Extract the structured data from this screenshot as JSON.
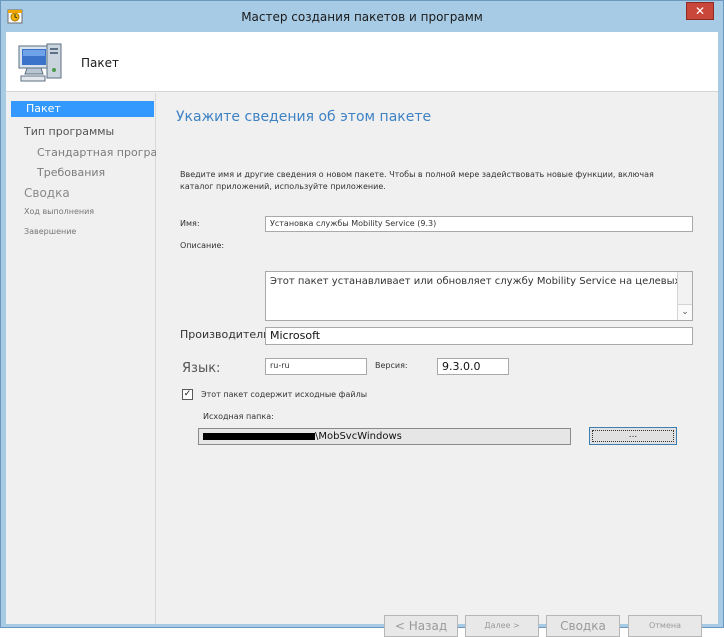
{
  "window": {
    "title": "Мастер создания пакетов и программ",
    "close_glyph": "✕"
  },
  "header": {
    "title": "Пакет",
    "icon": "computer-icon"
  },
  "nav": {
    "items": [
      {
        "label": "Пакет",
        "state": "active"
      },
      {
        "label": "Тип программы",
        "state": "normal"
      },
      {
        "label": "Стандартная программа",
        "state": "sub"
      },
      {
        "label": "Требования",
        "state": "sub"
      },
      {
        "label": "Сводка",
        "state": "dim"
      },
      {
        "label": "Ход выполнения",
        "state": "small"
      },
      {
        "label": "Завершение",
        "state": "small"
      }
    ]
  },
  "main": {
    "title": "Укажите сведения об этом пакете",
    "intro": "Введите имя и другие сведения о новом пакете. Чтобы в полной мере задействовать новые функции, включая каталог приложений, используйте приложение."
  },
  "form": {
    "name_label": "Имя:",
    "name_value": "Установка службы Mobility Service (9.3)",
    "description_label": "Описание:",
    "description_value": "Этот пакет устанавливает или обновляет службу Mobility Service на целевых компьютерах",
    "manufacturer_label": "Производитель:",
    "manufacturer_value": "Microsoft",
    "language_label": "Язык:",
    "language_value": "ru-ru",
    "version_label": "Версия:",
    "version_value": "9.3.0.0",
    "checkbox_label": "Этот пакет содержит исходные файлы",
    "checkbox_checked": true,
    "checkbox_glyph": "✓",
    "source_label": "Исходная папка:",
    "source_value": "\\MobSvcWindows",
    "browse_label": "...",
    "scroll_down_glyph": "⌄"
  },
  "buttons": {
    "back": "< Назад",
    "next": "Далее >",
    "summary": "Сводка",
    "cancel": "Отмена"
  },
  "colors": {
    "titlebar": "#a8cbe5",
    "accent": "#3399ff",
    "heading": "#3e82c4",
    "close": "#c8463a"
  }
}
